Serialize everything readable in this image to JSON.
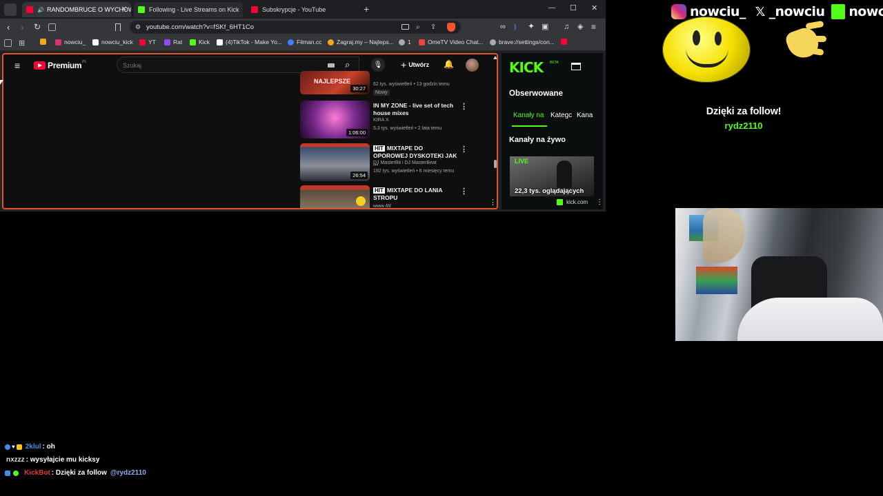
{
  "browser": {
    "tabs": [
      {
        "label": "RANDOMBRUCE O WYCHOW...",
        "active": true,
        "favicon_color": "#ff0033"
      },
      {
        "label": "Following - Live Streams on Kick",
        "active": false,
        "favicon_color": "#53fc18"
      },
      {
        "label": "Subskrypcje - YouTube",
        "active": false,
        "favicon_color": "#ff0033"
      }
    ],
    "new_tab": "+",
    "window_controls": {
      "minimize": "—",
      "maximize": "☐",
      "close": "✕"
    },
    "url": "youtube.com/watch?v=fSKf_6HT1Co",
    "bookmarks": [
      {
        "label": "",
        "icon": "yellow-square-icon",
        "color": "#f5a623"
      },
      {
        "label": "nowciu_",
        "icon": "instagram-icon",
        "color": "#e1306c"
      },
      {
        "label": "nowciu_kick",
        "icon": "x-icon",
        "color": "#ffffff"
      },
      {
        "label": "YT",
        "icon": "youtube-icon",
        "color": "#ff0033"
      },
      {
        "label": "Rat",
        "icon": "twitch-icon",
        "color": "#9146ff"
      },
      {
        "label": "Kick",
        "icon": "kick-icon",
        "color": "#53fc18"
      },
      {
        "label": "(4)TikTok - Make Yo...",
        "icon": "tiktok-icon",
        "color": "#ffffff"
      },
      {
        "label": "Filman.cc",
        "icon": "filman-icon",
        "color": "#3b82f6"
      },
      {
        "label": "Zagraj.my – Najleps...",
        "icon": "person-icon",
        "color": "#f5a623"
      },
      {
        "label": "1",
        "icon": "globe-icon",
        "color": "#aaaaaa"
      },
      {
        "label": "OmeTV Video Chat...",
        "icon": "ometv-icon",
        "color": "#e8453c"
      },
      {
        "label": "brave://settings/con...",
        "icon": "gear-icon",
        "color": "#aaaaaa"
      },
      {
        "label": "",
        "icon": "youtube-icon",
        "color": "#ff0033"
      }
    ]
  },
  "youtube": {
    "logo": "Premium",
    "logo_region": "PL",
    "search_placeholder": "Szukaj",
    "create_label": "Utwórz",
    "videos": [
      {
        "title": "NAJLEPSZE",
        "duration": "30:27",
        "channel": "",
        "meta": "62 tys. wyświetleń • 13 godzin temu",
        "badge": "Nowy",
        "thumb_color": "#6b1f1a"
      },
      {
        "title": "IN MY ZONE - live set of tech house mixes",
        "duration": "1:06:00",
        "channel": "KIRA X",
        "meta": "5,3 tys. wyświetleń • 2 lata temu",
        "badge": "",
        "thumb_color": "#7a2b8f"
      },
      {
        "title": "MIXTAPE DO OPOROWEJ DYSKOTEKI JAK ...",
        "duration": "26:54",
        "channel": "DJ MasterBit i DJ MasterBeat",
        "meta": "192 tys. wyświetleń • 6 miesięcy temu",
        "badge": "",
        "thumb_color": "#3a4a6a"
      },
      {
        "title": "MIXTAPE DO LANIA STROPU",
        "duration": "",
        "channel": "ɴɴɴɴ-ꟿ",
        "meta": "",
        "badge": "",
        "thumb_color": "#5a4a3a"
      }
    ]
  },
  "kick_sidebar": {
    "logo": "KICK",
    "logo_beta": "BETA",
    "following_title": "Obserwowane",
    "tabs": [
      "Kanały na",
      "Kategc",
      "Kana"
    ],
    "live_title": "Kanały na żywo",
    "live_badge": "LIVE",
    "viewers": "22,3 tys. oglądających",
    "domain": "kick.com"
  },
  "overlay": {
    "socials": [
      {
        "handle": "nowciu_",
        "icon": "instagram-icon",
        "color": "#e1306c"
      },
      {
        "handle": "_nowciu",
        "icon": "x-icon",
        "color": "#ffffff"
      },
      {
        "handle": "nowciu",
        "icon": "kick-icon",
        "color": "#53fc18"
      }
    ],
    "follow_message": "Dzięki za follow!",
    "follower_name": "rydz2110",
    "follower_color": "#53fc18"
  },
  "chat": [
    {
      "user": "2klul",
      "user_color": "#3b8eea",
      "text": ": oh"
    },
    {
      "user": "nxzzz",
      "user_color": "#dddddd",
      "text": ": wysyłajcie mu kicksy"
    },
    {
      "user": "KickBot",
      "user_color": "#e53935",
      "text": ": Dzięki za follow",
      "mention": "@rydz2110",
      "mention_color": "#8ab4f8"
    }
  ]
}
